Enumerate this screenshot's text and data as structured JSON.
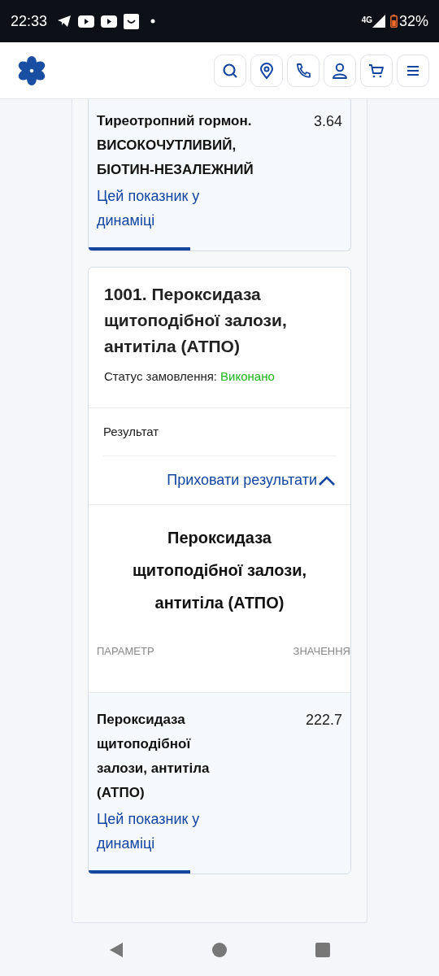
{
  "status_bar": {
    "time": "22:33",
    "network": "4G",
    "battery": "32%"
  },
  "previous_result": {
    "parameter": "Тиреотропний гормон. ВИСОКОЧУТЛИВИЙ, БІОТИН-НЕЗАЛЕЖНИЙ",
    "value": "3.64",
    "link": "Цей показник у динаміці"
  },
  "order": {
    "title": "1001. Пероксидаза щитоподібної залози, антитіла (АТПО)",
    "status_label": "Статус замовлення:",
    "status": "Виконано",
    "result_label": "Результат",
    "toggle": "Приховати результати",
    "expanded": true,
    "result_title": "Пероксидаза щитоподібної залози, антитіла (АТПО)",
    "columns": [
      "ПАРАМЕТР",
      "ЗНАЧЕННЯ"
    ],
    "rows": [
      {
        "parameter": "Пероксидаза щитоподібної залози, антитіла (АТПО)",
        "value": "222.7",
        "link": "Цей показник у динаміці"
      }
    ]
  }
}
